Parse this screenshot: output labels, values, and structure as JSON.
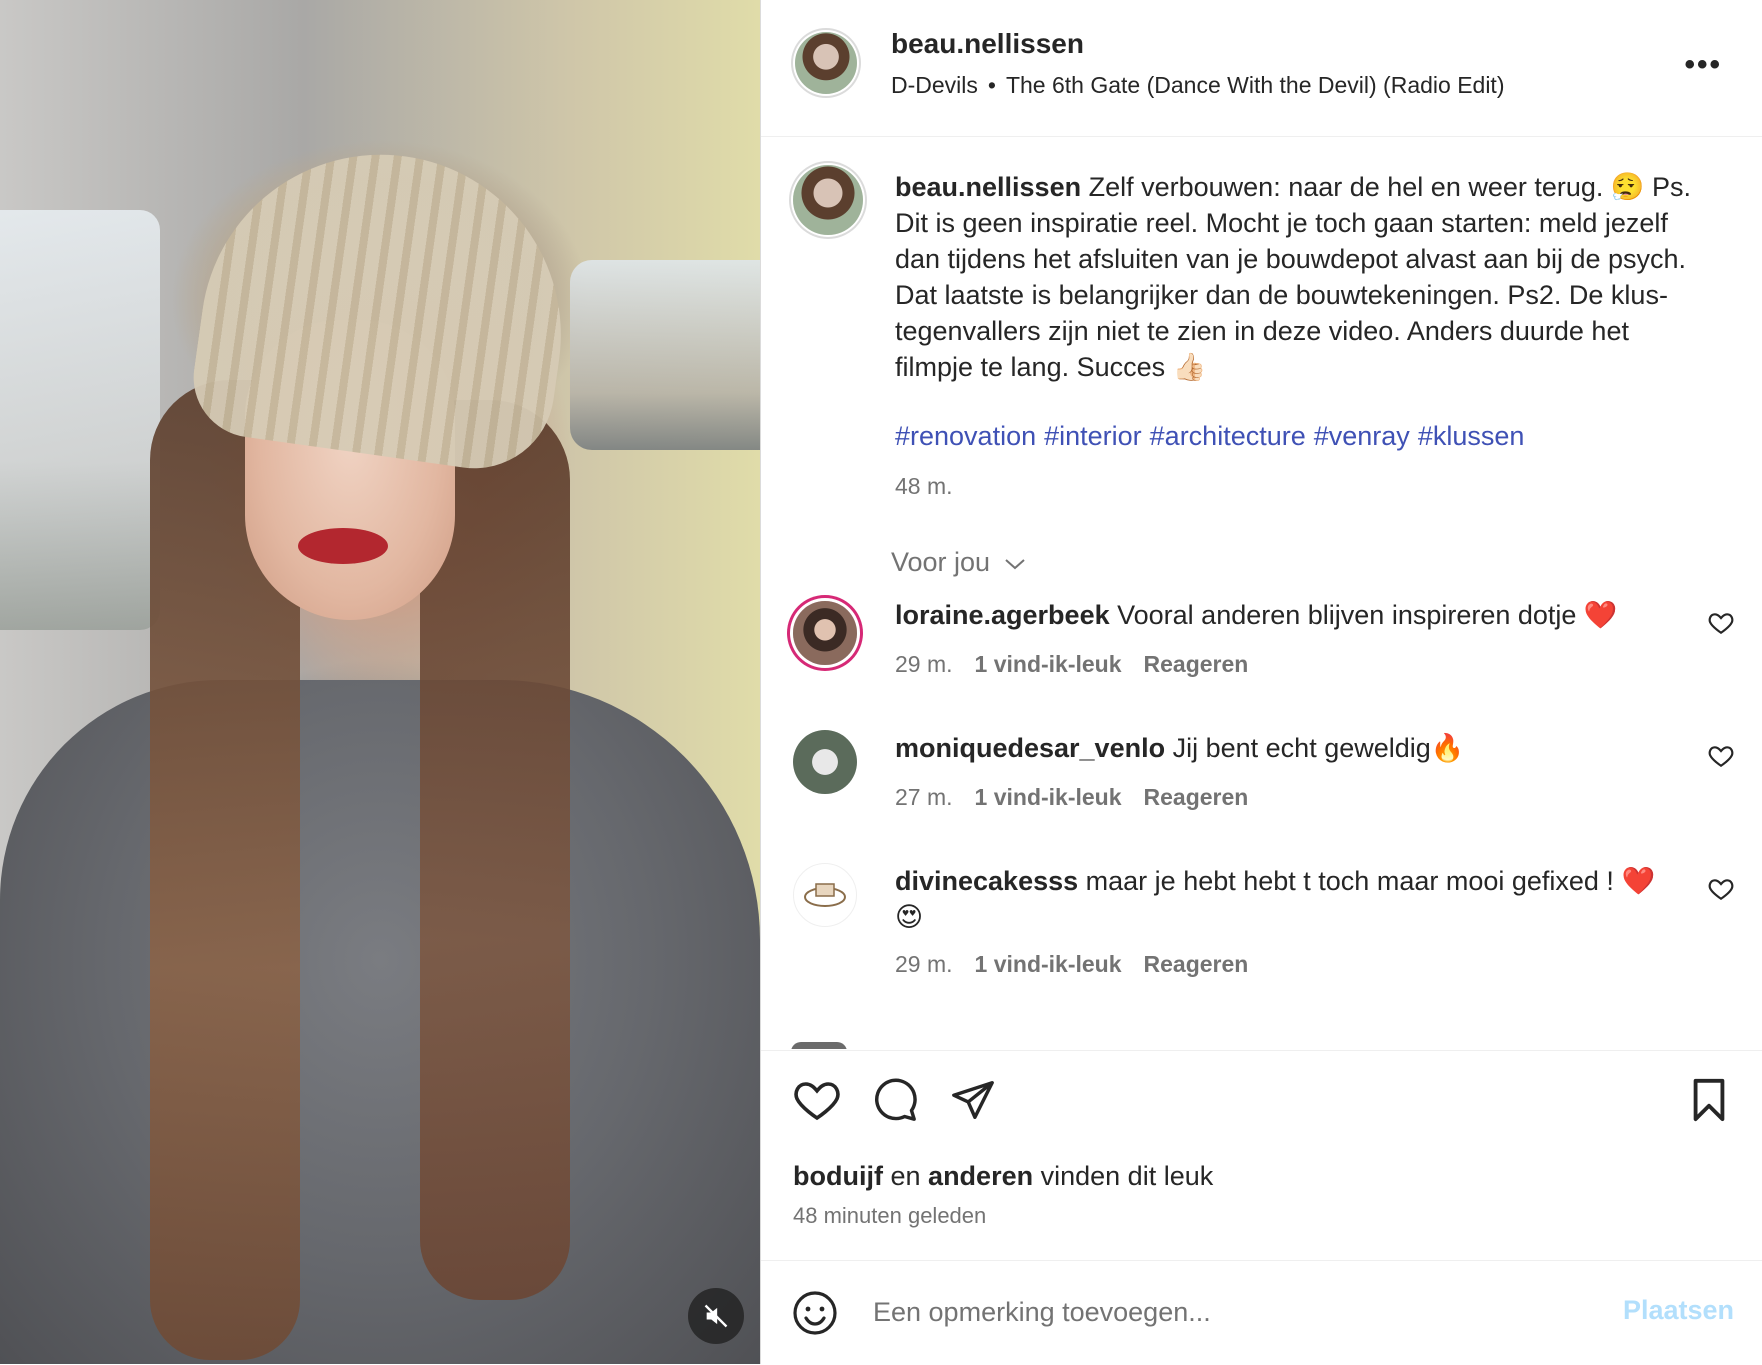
{
  "post": {
    "username": "beau.nellissen",
    "music_artist": "D-Devils",
    "music_track": "The 6th Gate (Dance With the Devil) (Radio Edit)"
  },
  "caption": {
    "username": "beau.nellissen",
    "text": "Zelf verbouwen: naar de hel en weer terug. 😮‍💨 Ps. Dit is geen inspiratie reel. Mocht je toch gaan starten: meld jezelf dan tijdens het afsluiten van je bouwdepot alvast aan bij de psych. Dat laatste is belangrijker dan de bouwtekeningen. Ps2. De klus-tegenvallers zijn niet te zien in deze video. Anders duurde het filmpje te lang. Succes 👍🏻",
    "hashtags": [
      "#renovation",
      "#interior",
      "#architecture",
      "#venray",
      "#klussen"
    ],
    "time": "48 m."
  },
  "sort_label": "Voor jou",
  "comments": [
    {
      "username": "loraine.agerbeek",
      "text": "Vooral anderen blijven inspireren dotje ❤️",
      "time": "29 m.",
      "likes": "1 vind-ik-leuk",
      "reply": "Reageren"
    },
    {
      "username": "moniquedesar_venlo",
      "text": "Jij bent echt geweldig🔥",
      "time": "27 m.",
      "likes": "1 vind-ik-leuk",
      "reply": "Reageren"
    },
    {
      "username": "divinecakesss",
      "text": "maar je hebt hebt t toch maar mooi gefixed ! ❤️😍",
      "time": "29 m.",
      "likes": "1 vind-ik-leuk",
      "reply": "Reageren"
    }
  ],
  "likes_summary": {
    "user": "boduijf",
    "connector": "en",
    "others": "anderen",
    "suffix": "vinden dit leuk"
  },
  "posted_ago": "48 minuten geleden",
  "composer": {
    "placeholder": "Een opmerking toevoegen...",
    "post_label": "Plaatsen"
  },
  "icons": {
    "mute": "speaker-muted-icon",
    "more": "more-options-icon",
    "like": "heart-icon",
    "comment": "comment-bubble-icon",
    "share": "paper-plane-icon",
    "save": "bookmark-icon",
    "emoji": "emoji-smiley-icon"
  },
  "colors": {
    "hashtag": "#3f51b5",
    "post_button": "#b2dffc",
    "muted_text": "#737373"
  }
}
